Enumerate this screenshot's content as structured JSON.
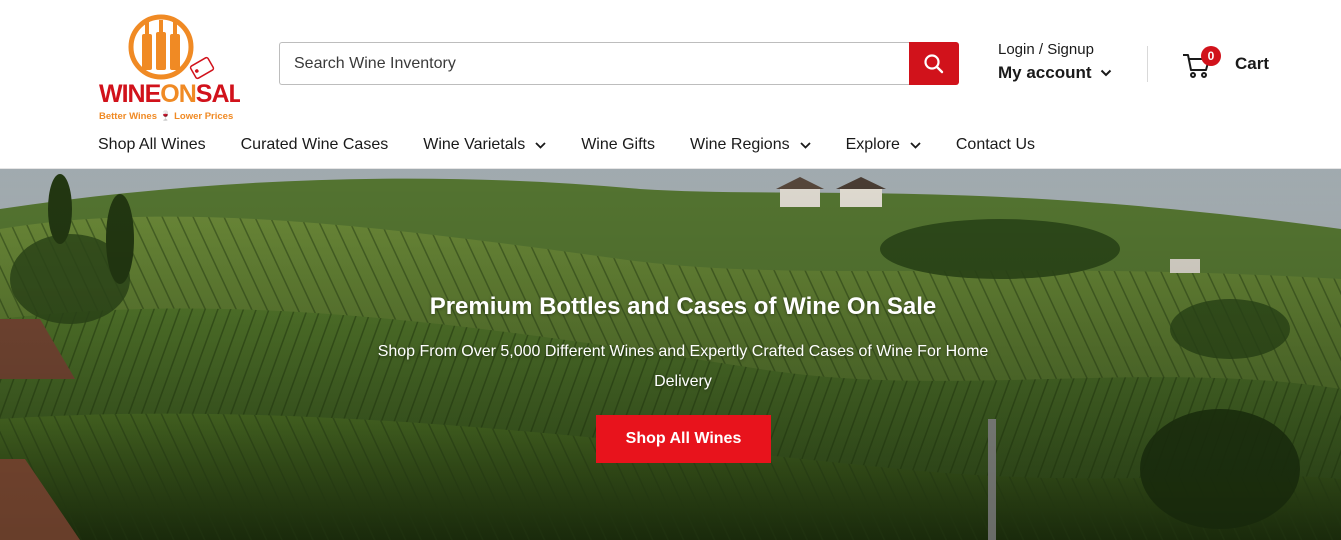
{
  "logo": {
    "brand_wine": "WINE",
    "brand_on": "ON",
    "brand_sale": "SALE",
    "tagline": "Better Wines 🍷 Lower Prices",
    "colors": {
      "orange": "#f08a24",
      "red": "#d1121b"
    }
  },
  "search": {
    "placeholder": "Search Wine Inventory",
    "value": "",
    "icon": "search-icon"
  },
  "account": {
    "login_label": "Login / Signup",
    "account_label": "My account",
    "icon": "chevron-down-icon"
  },
  "cart": {
    "label": "Cart",
    "count": "0",
    "icon": "cart-icon"
  },
  "nav": {
    "items": [
      {
        "label": "Shop All Wines",
        "has_dropdown": false
      },
      {
        "label": "Curated Wine Cases",
        "has_dropdown": false
      },
      {
        "label": "Wine Varietals",
        "has_dropdown": true
      },
      {
        "label": "Wine Gifts",
        "has_dropdown": false
      },
      {
        "label": "Wine Regions",
        "has_dropdown": true
      },
      {
        "label": "Explore",
        "has_dropdown": true
      },
      {
        "label": "Contact Us",
        "has_dropdown": false
      }
    ]
  },
  "hero": {
    "title": "Premium Bottles and Cases of Wine On Sale",
    "subtitle": "Shop From Over 5,000 Different Wines and Expertly Crafted Cases of Wine For Home Delivery",
    "button_label": "Shop All Wines"
  },
  "colors": {
    "accent_red": "#d1121b",
    "button_red": "#e8131c"
  }
}
